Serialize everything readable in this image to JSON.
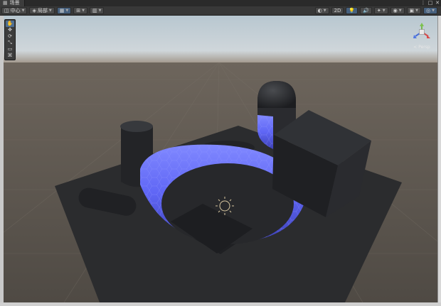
{
  "tab": {
    "icon": "scene-icon",
    "label": "场景"
  },
  "window_controls": {
    "menu": "⋮",
    "maximize": "□",
    "close": "✕"
  },
  "toolbar": {
    "pivot_label": "中心",
    "space_label": "局部",
    "right_mode": "2D"
  },
  "tools": [
    {
      "name": "hand-tool",
      "glyph": "✋",
      "active": true
    },
    {
      "name": "move-tool",
      "glyph": "✥",
      "active": false
    },
    {
      "name": "rotate-tool",
      "glyph": "⟳",
      "active": false
    },
    {
      "name": "scale-tool",
      "glyph": "⤡",
      "active": false
    },
    {
      "name": "rect-tool",
      "glyph": "▭",
      "active": false
    },
    {
      "name": "transform-tool",
      "glyph": "⌘",
      "active": false
    }
  ],
  "scene": {
    "persp_label": "< Persp",
    "colors": {
      "background": "#5e5850",
      "sky": "#c7d1d7",
      "plane": "#2b2c2e",
      "object": "#25272a",
      "glow": "#6e73ff"
    }
  }
}
